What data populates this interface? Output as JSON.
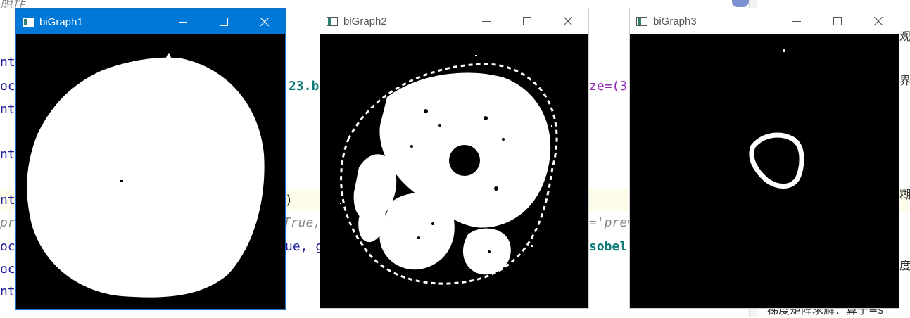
{
  "editor": {
    "fragments": [
      {
        "id": "f1",
        "text": "照作",
        "cls": "ital"
      },
      {
        "id": "f2",
        "text": "nt",
        "cls": "kw"
      },
      {
        "id": "f3",
        "text": "oce",
        "cls": "kw"
      },
      {
        "id": "f4",
        "text": "nt",
        "cls": "kw"
      },
      {
        "id": "f5",
        "text": "nt",
        "cls": "kw"
      },
      {
        "id": "f6",
        "text": "nt",
        "cls": "kw"
      },
      {
        "id": "f7",
        "text": "pro",
        "cls": "ital"
      },
      {
        "id": "f8",
        "text": "oce",
        "cls": "kw"
      },
      {
        "id": "f9",
        "text": "oce",
        "cls": "kw"
      },
      {
        "id": "f10",
        "text": "nt",
        "cls": "kw"
      },
      {
        "id": "f11",
        "text": "23.b",
        "cls": "bold-teal"
      },
      {
        "id": "f12",
        "text": ")",
        "cls": "dark"
      },
      {
        "id": "f13",
        "text": "True,",
        "cls": "ital"
      },
      {
        "id": "f14",
        "text": "ue, g",
        "cls": "kw"
      },
      {
        "id": "f15",
        "text": "ze=(3",
        "cls": "purple"
      },
      {
        "id": "f16",
        "text": "='prev",
        "cls": "ital"
      },
      {
        "id": "f17",
        "text": "sobel",
        "cls": "bold-teal"
      },
      {
        "id": "f18",
        "text": "观",
        "cls": "cjk"
      },
      {
        "id": "f19",
        "text": "界",
        "cls": "cjk"
      },
      {
        "id": "f20",
        "text": "糊",
        "cls": "cjk"
      },
      {
        "id": "f21",
        "text": "度",
        "cls": "cjk"
      },
      {
        "id": "f22",
        "text": "梯度矩阵求解：算子=s",
        "cls": "cjk"
      }
    ]
  },
  "windows": [
    {
      "id": "w1",
      "title": "biGraph1",
      "active": true
    },
    {
      "id": "w2",
      "title": "biGraph2",
      "active": false
    },
    {
      "id": "w3",
      "title": "biGraph3",
      "active": false
    }
  ],
  "colors": {
    "active_titlebar": "#0078d7",
    "inactive_titlebar": "#ffffff",
    "image_background": "#000000",
    "image_foreground": "#ffffff"
  },
  "icons": [
    "app-window-icon",
    "minimize-icon",
    "maximize-icon",
    "close-icon"
  ]
}
